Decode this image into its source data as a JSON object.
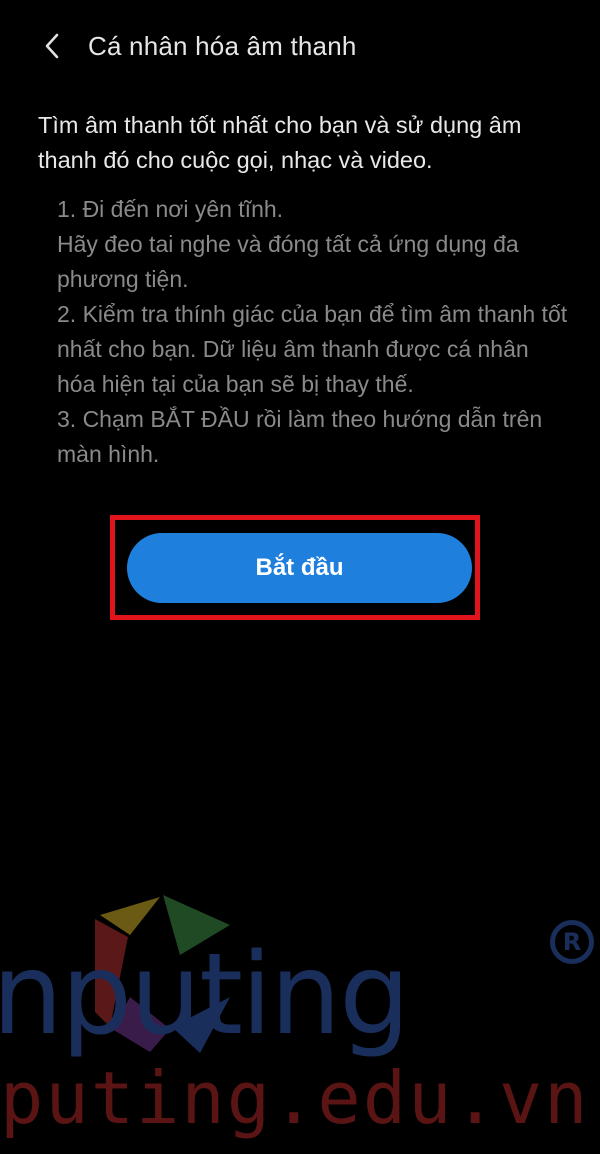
{
  "header": {
    "back_icon": "chevron-left-icon",
    "title": "Cá nhân hóa âm thanh"
  },
  "intro": {
    "description": "Tìm âm thanh tốt nhất cho bạn và sử dụng âm thanh đó cho cuộc gọi, nhạc và video."
  },
  "steps": [
    "1. Đi đến nơi yên tĩnh.",
    "Hãy đeo tai nghe và đóng tất cả ứng dụng đa phương tiện.",
    "2. Kiểm tra thính giác của bạn để tìm âm thanh tốt nhất cho bạn. Dữ liệu âm thanh được cá nhân hóa hiện tại của bạn sẽ bị thay thế.",
    "3. Chạm BẮT ĐẦU rồi làm theo hướng dẫn trên màn hình."
  ],
  "actions": {
    "start_label": "Bắt đầu"
  },
  "watermark": {
    "line1": "nputing",
    "registered": "R",
    "line2": "puting.edu.vn"
  },
  "colors": {
    "background": "#000000",
    "button": "#1e7fdc",
    "highlight": "#e2141b"
  }
}
